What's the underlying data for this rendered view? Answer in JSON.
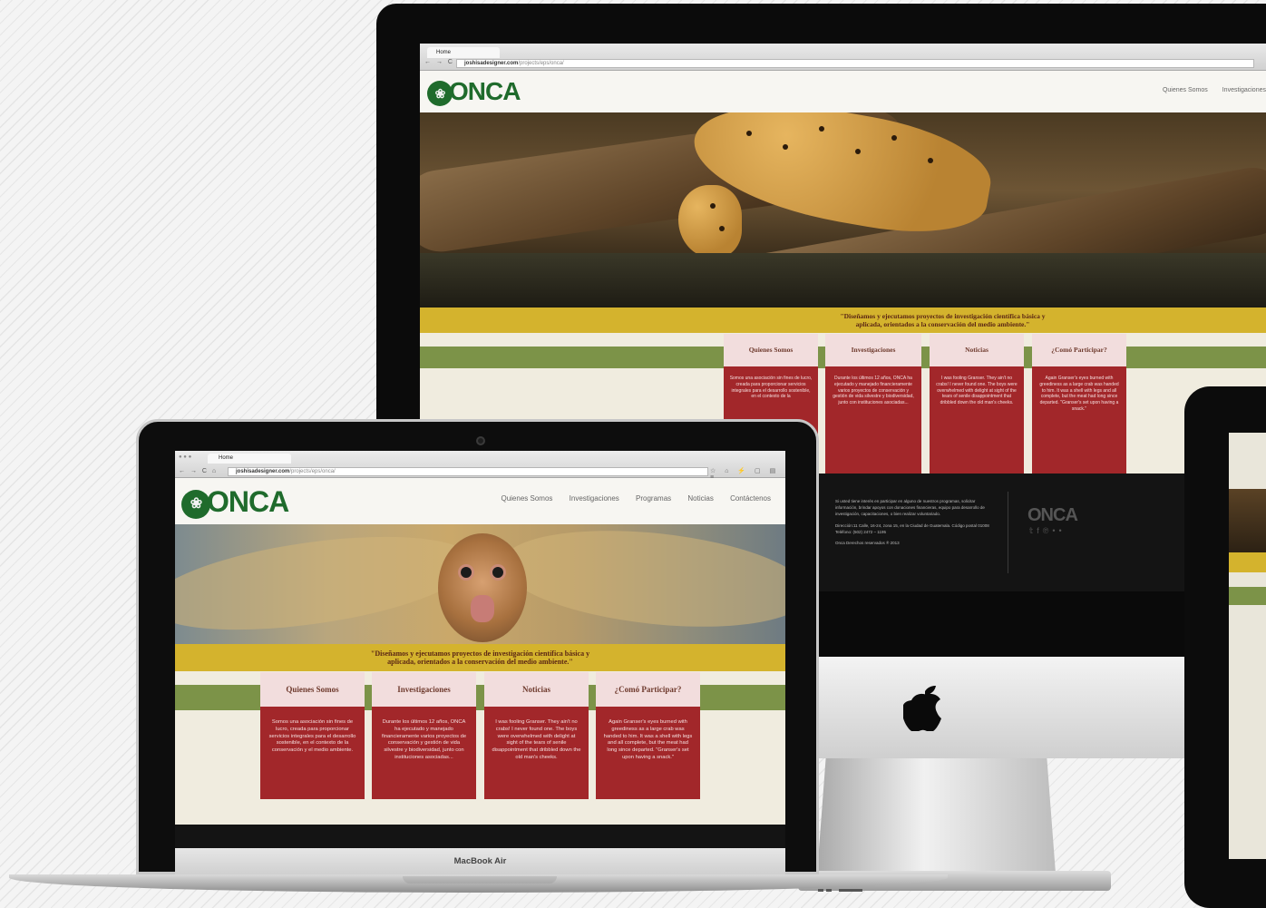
{
  "browser": {
    "tab_title": "Home",
    "url_domain": "joshisadesigner.com",
    "url_path": "/projects/eps/onca/"
  },
  "site": {
    "logo_text": "ONCA",
    "nav": [
      "Quienes Somos",
      "Investigaciones",
      "Programas",
      "Noticias",
      "Contáctenos"
    ],
    "tagline_line1": "\"Diseñamos y ejecutamos proyectos de investigación científica básica y",
    "tagline_line2": "aplicada, orientados a la conservación del medio ambiente.\"",
    "cards": [
      {
        "title": "Quienes Somos",
        "body": "Somos una asociación sin fines de lucro, creada para proporcionar servicios integrales para el desarrollo sostenible, en el contexto de la conservación y el medio ambiente."
      },
      {
        "title": "Investigaciones",
        "body": "Durante los últimos 12 años, ONCA ha ejecutado y manejado financieramente varios proyectos de conservación y gestión de vida silvestre y biodiversidad, junto con instituciones asociadas..."
      },
      {
        "title": "Noticias",
        "body": "I was fooling Granser. They ain't no crabs! I never found one. The boys were overwhelmed with delight at sight of the tears of senile disappointment that dribbled down the old man's cheeks."
      },
      {
        "title": "¿Comó Participar?",
        "body": "Again Granser's eyes burned with greediness as a large crab was handed to him. It was a shell with legs and all complete, but the meat had long since departed. \"Granser's set upon having a snack.\""
      }
    ],
    "imac_card_bodies": [
      "Somos una asociación sin fines de lucro, creada para proporcionar servicios integrales para el desarrollo sostenible, en el contexto de la",
      "Durante los últimos 12 años, ONCA ha ejecutado y manejado financieramente varios proyectos de conservación y gestión de vida silvestre y biodiversidad, junto con instituciones asociadas...",
      "I was fooling Granser. They ain't no crabs! I never found one. The boys were overwhelmed with delight at sight of the tears of senile disappointment that dribbled down the old man's cheeks.",
      "Again Granser's eyes burned with greediness as a large crab was handed to him. It was a shell with legs and all complete, but the meat had long since departed. \"Granser's set upon having a snack.\""
    ],
    "footer": {
      "paragraph": "Si usted tiene interés en participar en alguno de nuestros programas, solicitar información, brindar apoyos con donaciones financieras, equipo para desarrollo de investigación, capacitaciones, o bien realizar voluntariado.",
      "address": "Dirección:11 Calle, 16-24, zona 15, en la Ciudad de Guatemala. Código postal 01008",
      "phone": "Teléfono: (502) 2472 – 1195",
      "copyright": "Onca Derechos reservados ® 2013",
      "social_icons": [
        "twitter-icon",
        "facebook-icon",
        "pinterest-icon",
        "flickr-icon"
      ]
    }
  },
  "devices": {
    "laptop_label": "MacBook Air",
    "imac_nav_visible": [
      "Quienes Somos",
      "Investigaciones"
    ]
  },
  "colors": {
    "logo_green": "#1f6b2c",
    "band_yellow": "#d4b32d",
    "band_green": "#7c9348",
    "card_red": "#a2272a",
    "card_title_bg": "#f2dddd",
    "footer_bg": "#141414"
  }
}
